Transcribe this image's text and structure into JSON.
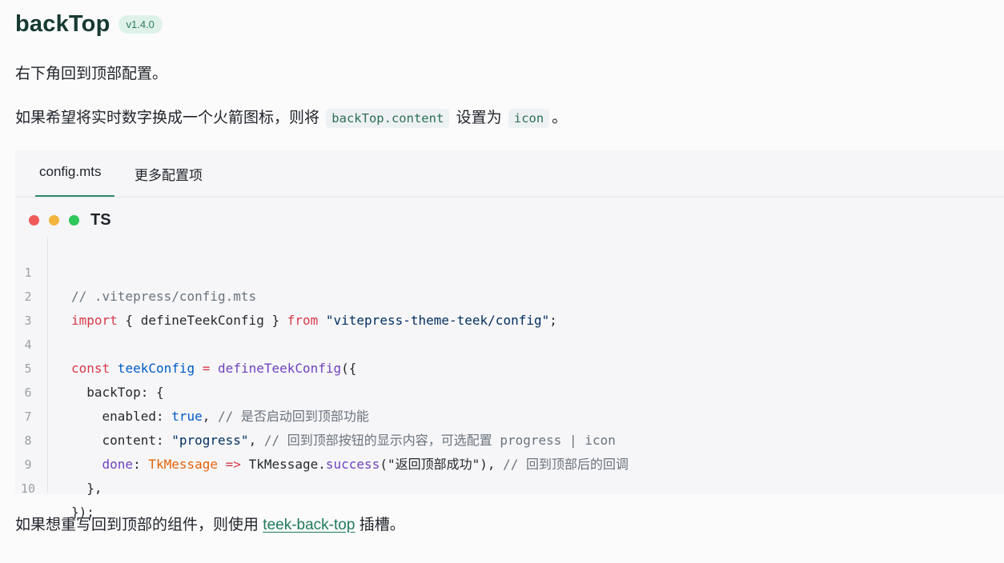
{
  "title": "backTop",
  "version": "v1.4.0",
  "intro": "右下角回到顶部配置。",
  "content_note": {
    "before": "如果希望将实时数字换成一个火箭图标，则将",
    "code1": "backTop.content",
    "middle": "设置为",
    "code2": "icon",
    "after": "。"
  },
  "tabs": {
    "active": "config.mts",
    "other": "更多配置项"
  },
  "code_lang": "TS",
  "code_lines": {
    "l1": "// .vitepress/config.mts",
    "l2_import": "import",
    "l2_mid": " { defineTeekConfig } ",
    "l2_from": "from",
    "l2_str": " \"vitepress-theme-teek/config\"",
    "l2_end": ";",
    "l4_const": "const",
    "l4_name": " teekConfig",
    "l4_eq": " = ",
    "l4_fn": "defineTeekConfig",
    "l4_end": "({",
    "l5": "  backTop: {",
    "l6_key": "    enabled: ",
    "l6_val": "true",
    "l6_comma": ", ",
    "l6_comment": "// 是否启动回到顶部功能",
    "l7_key": "    content: ",
    "l7_val": "\"progress\"",
    "l7_comma": ", ",
    "l7_comment": "// 回到顶部按钮的显示内容，可选配置 progress | icon",
    "l8_indent": "    ",
    "l8_key": "done",
    "l8_colon": ": ",
    "l8_param": "TkMessage",
    "l8_arrow": " => ",
    "l8_obj": "TkMessage.",
    "l8_method": "success",
    "l8_args": "(\"返回顶部成功\"), ",
    "l8_comment": "// 回到顶部后的回调",
    "l9": "  },",
    "l10": "});"
  },
  "line_numbers": [
    "1",
    "2",
    "3",
    "4",
    "5",
    "6",
    "7",
    "8",
    "9",
    "10"
  ],
  "slot_note": {
    "before": "如果想重写回到顶部的组件，则使用",
    "link": "teek-back-top",
    "after": "插槽。"
  }
}
